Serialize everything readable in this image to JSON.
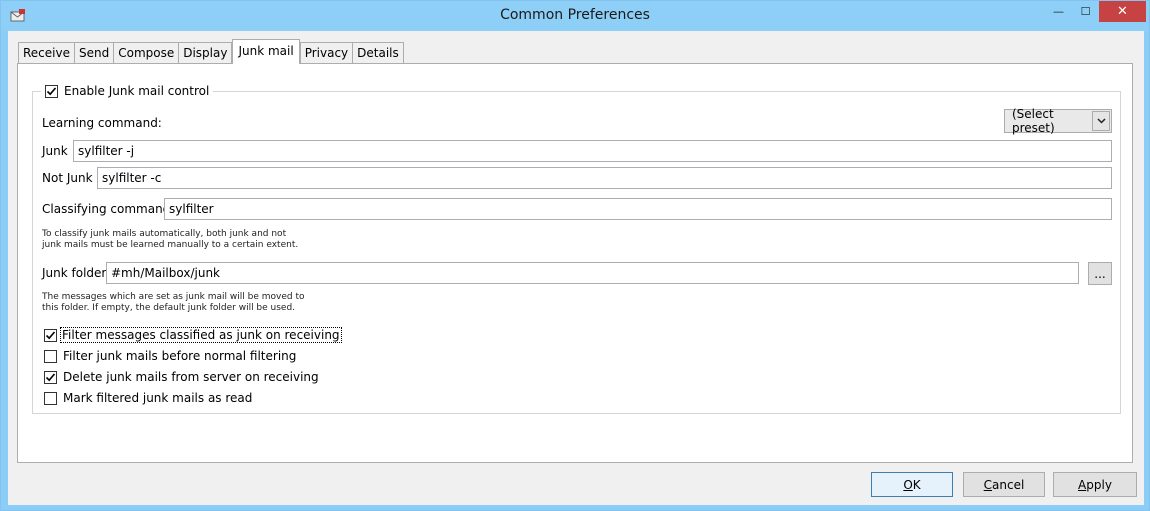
{
  "window": {
    "title": "Common Preferences",
    "close_glyph": "✕",
    "minimize_glyph": "—",
    "maximize_glyph": "☐"
  },
  "tabs": [
    {
      "label": "Receive"
    },
    {
      "label": "Send"
    },
    {
      "label": "Compose"
    },
    {
      "label": "Display"
    },
    {
      "label": "Junk mail"
    },
    {
      "label": "Privacy"
    },
    {
      "label": "Details"
    }
  ],
  "junk": {
    "enable_label": "Enable Junk mail control",
    "enable_checked": true,
    "learning_label": "Learning command:",
    "preset_label": "(Select preset)",
    "junk_label": "Junk",
    "junk_value": "sylfilter -j",
    "notjunk_label": "Not Junk",
    "notjunk_value": "sylfilter -c",
    "classify_label": "Classifying command",
    "classify_value": "sylfilter",
    "classify_hint_1": "To classify junk mails automatically, both junk and not",
    "classify_hint_2": "junk mails must be learned manually to a certain extent.",
    "folder_label": "Junk folder",
    "folder_value": "#mh/Mailbox/junk",
    "browse_label": "...",
    "folder_hint_1": "The messages which are set as junk mail will be moved to",
    "folder_hint_2": "this folder. If empty, the default junk folder will be used.",
    "options": [
      {
        "label": "Filter messages classified as junk on receiving",
        "checked": true
      },
      {
        "label": "Filter junk mails before normal filtering",
        "checked": false
      },
      {
        "label": "Delete junk mails from server on receiving",
        "checked": true
      },
      {
        "label": "Mark filtered junk mails as read",
        "checked": false
      }
    ]
  },
  "buttons": {
    "ok": "OK",
    "cancel": "Cancel",
    "apply": "Apply"
  },
  "colors": {
    "titlebar": "#8dcff7",
    "close": "#c74242",
    "primary_border": "#3c7fb1"
  }
}
